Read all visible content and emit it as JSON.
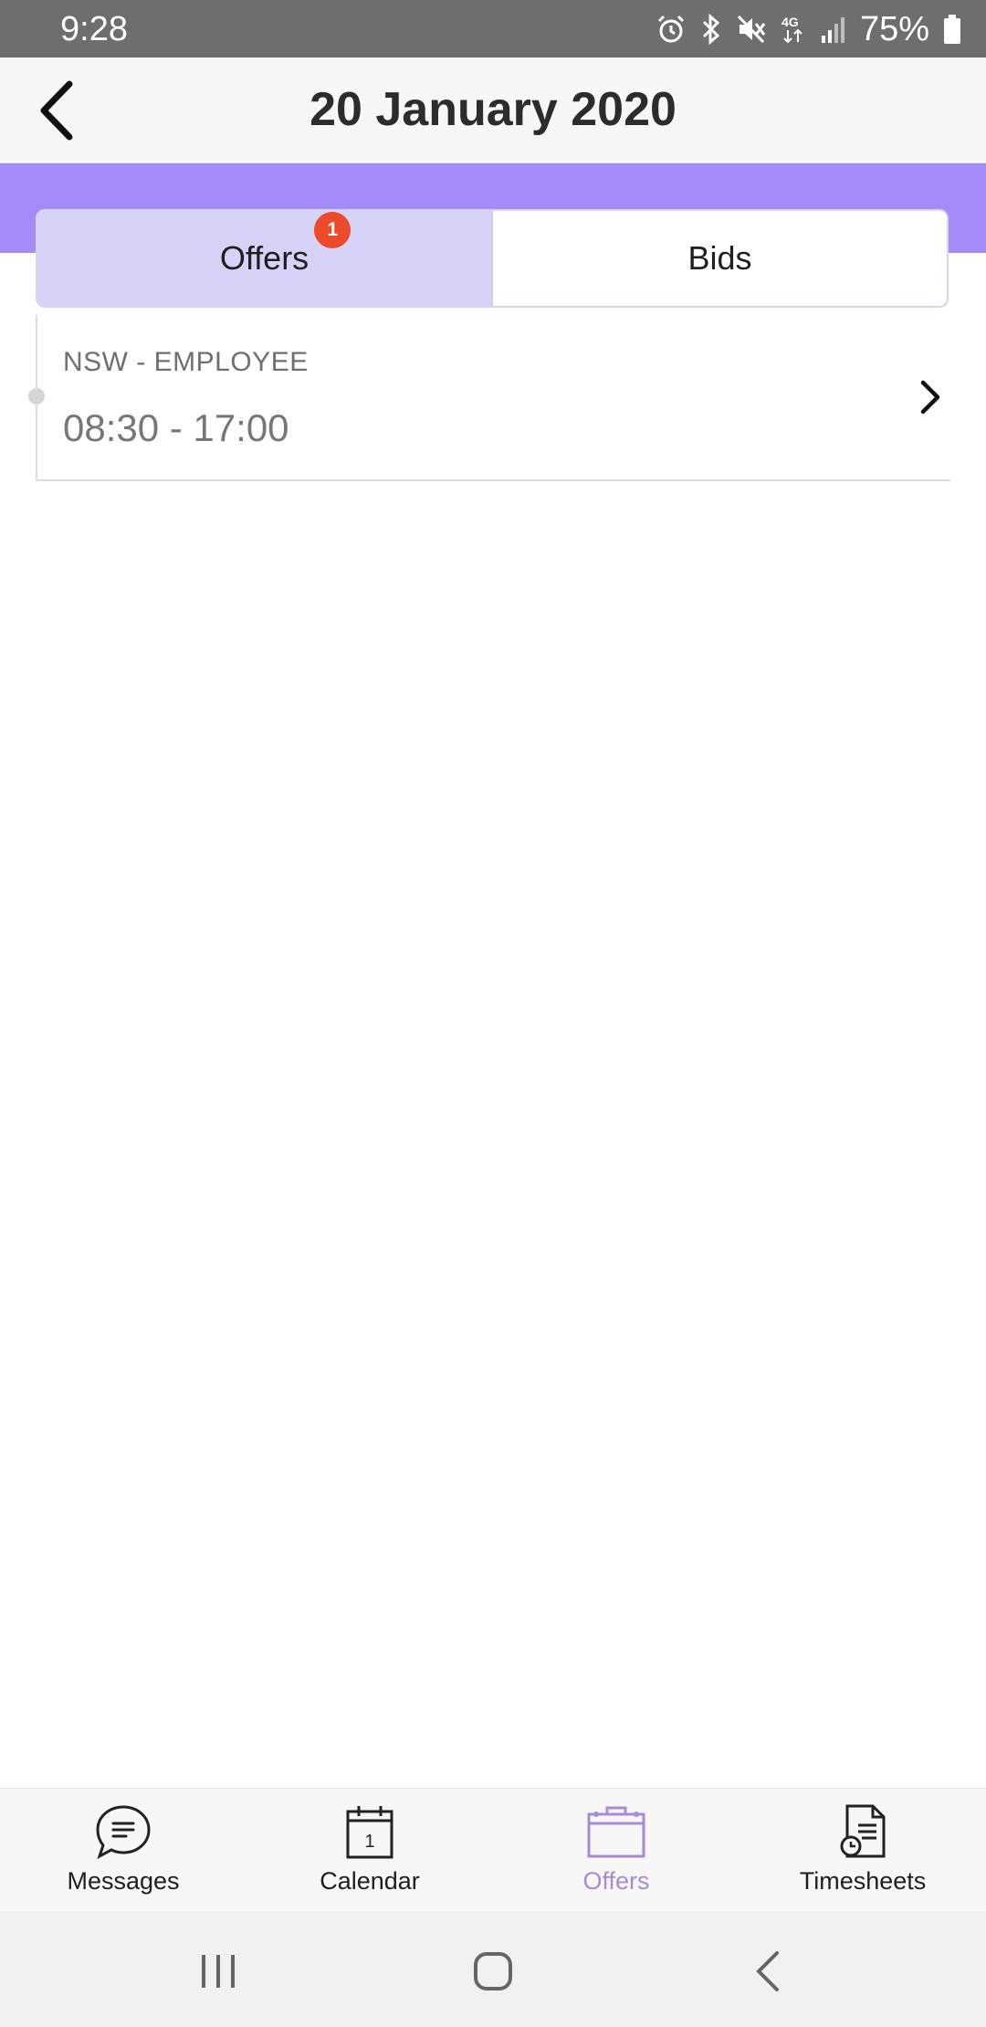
{
  "status_bar": {
    "time": "9:28",
    "battery": "75%",
    "network": "4G",
    "icons": [
      "alarm-icon",
      "bluetooth-icon",
      "mute-icon",
      "4g-icon",
      "signal-icon",
      "battery-icon"
    ]
  },
  "header": {
    "title": "20 January 2020",
    "back_icon": "chevron-left-icon"
  },
  "colors": {
    "accent": "#a58bfa",
    "active_tab_bg": "#d7d3f8",
    "badge": "#ec4a2b",
    "nav_active": "#a78bd6"
  },
  "tabs": [
    {
      "label": "Offers",
      "active": true,
      "badge": "1"
    },
    {
      "label": "Bids",
      "active": false
    }
  ],
  "shifts": [
    {
      "location": "NSW - EMPLOYEE",
      "time": "08:30 - 17:00",
      "icon": "chevron-right-icon"
    }
  ],
  "bottom_nav": {
    "items": [
      {
        "label": "Messages",
        "icon": "chat-bubble-icon",
        "active": false
      },
      {
        "label": "Calendar",
        "icon": "calendar-icon",
        "icon_text": "1",
        "active": false
      },
      {
        "label": "Offers",
        "icon": "briefcase-icon",
        "active": true
      },
      {
        "label": "Timesheets",
        "icon": "timesheet-icon",
        "active": false
      }
    ]
  },
  "system_nav": [
    "recents-icon",
    "home-icon",
    "back-icon"
  ]
}
